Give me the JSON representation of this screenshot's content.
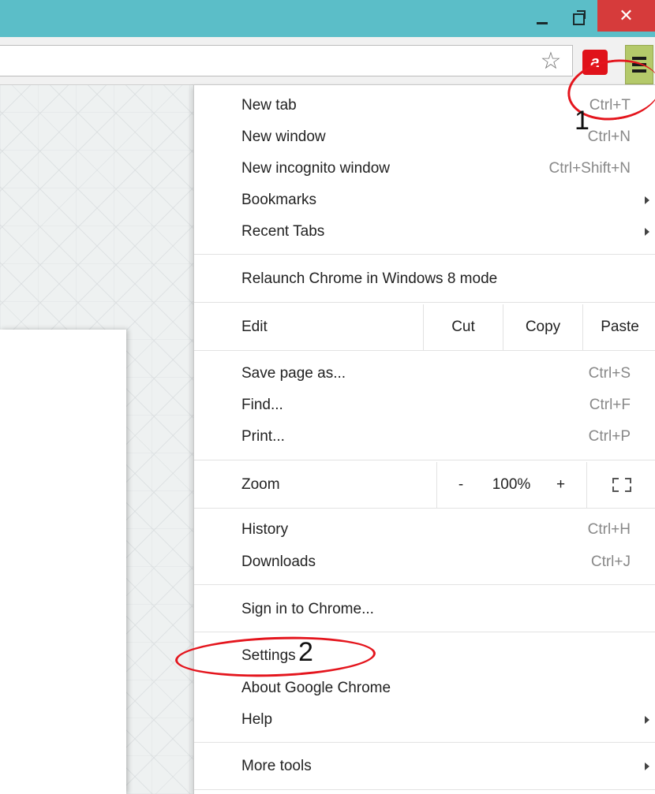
{
  "window": {
    "minimize_label": "_",
    "maximize_label": "",
    "close_label": "✕"
  },
  "toolbar": {
    "bookmark_star": "☆",
    "extension_label": "a",
    "menu_icon": "hamburger-icon"
  },
  "menu": {
    "items": [
      {
        "label": "New tab",
        "shortcut": "Ctrl+T"
      },
      {
        "label": "New window",
        "shortcut": "Ctrl+N"
      },
      {
        "label": "New incognito window",
        "shortcut": "Ctrl+Shift+N"
      },
      {
        "label": "Bookmarks",
        "shortcut": ""
      },
      {
        "label": "Recent Tabs",
        "shortcut": ""
      },
      {
        "label": "Relaunch Chrome in Windows 8 mode",
        "shortcut": ""
      },
      {
        "label": "Save page as...",
        "shortcut": "Ctrl+S"
      },
      {
        "label": "Find...",
        "shortcut": "Ctrl+F"
      },
      {
        "label": "Print...",
        "shortcut": "Ctrl+P"
      },
      {
        "label": "History",
        "shortcut": "Ctrl+H"
      },
      {
        "label": "Downloads",
        "shortcut": "Ctrl+J"
      },
      {
        "label": "Sign in to Chrome...",
        "shortcut": ""
      },
      {
        "label": "Settings",
        "shortcut": ""
      },
      {
        "label": "About Google Chrome",
        "shortcut": ""
      },
      {
        "label": "Help",
        "shortcut": ""
      },
      {
        "label": "More tools",
        "shortcut": ""
      }
    ],
    "edit": {
      "label": "Edit",
      "cut": "Cut",
      "copy": "Copy",
      "paste": "Paste"
    },
    "zoom": {
      "label": "Zoom",
      "minus": "-",
      "value": "100%",
      "plus": "+"
    }
  },
  "annotations": {
    "step1": "1",
    "step2": "2",
    "color": "#e4151d"
  }
}
